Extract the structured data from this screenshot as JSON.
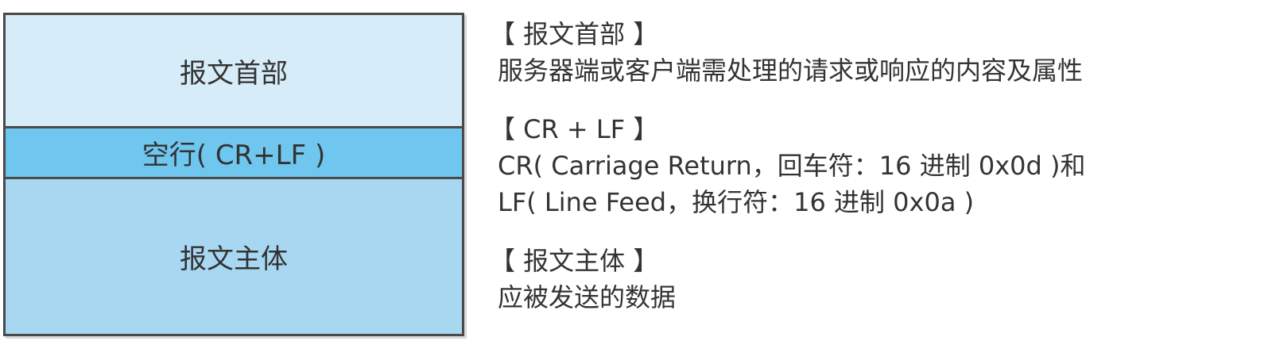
{
  "colors": {
    "header_fill": "#d6ecf8",
    "blank_fill": "#6fc6ee",
    "body_fill": "#a8d7f2",
    "border": "#4a4a4a",
    "text": "#333333"
  },
  "diagram": {
    "header_label": "报文首部",
    "blank_line_label": "空行( CR+LF )",
    "body_label": "报文主体"
  },
  "notes": {
    "header": {
      "title": "【 报文首部 】",
      "lines": [
        "服务器端或客户端需处理的请求或响应的内容及属性"
      ]
    },
    "crlf": {
      "title": "【 CR + LF 】",
      "lines": [
        "CR( Carriage Return，回车符：16 进制 0x0d )和",
        "LF( Line Feed，换行符：16 进制 0x0a )"
      ]
    },
    "body": {
      "title": "【 报文主体 】",
      "lines": [
        "应被发送的数据"
      ]
    }
  }
}
